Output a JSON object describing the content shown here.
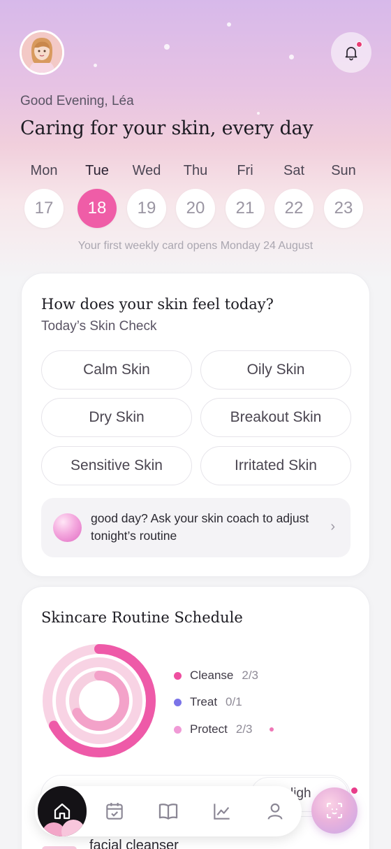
{
  "header": {
    "greeting": "Good Evening, Léa",
    "headline": "Caring for your skin, every day",
    "notification_dot_color": "#e83c74"
  },
  "week": {
    "days": [
      {
        "name": "Mon",
        "date": "17",
        "selected": false
      },
      {
        "name": "Tue",
        "date": "18",
        "selected": true
      },
      {
        "name": "Wed",
        "date": "19",
        "selected": false
      },
      {
        "name": "Thu",
        "date": "20",
        "selected": false
      },
      {
        "name": "Fri",
        "date": "21",
        "selected": false
      },
      {
        "name": "Sat",
        "date": "22",
        "selected": false
      },
      {
        "name": "Sun",
        "date": "23",
        "selected": false
      }
    ],
    "note": "Your first weekly card opens Monday 24 August",
    "accent": "#ef5da7"
  },
  "skin_check": {
    "title": "How does your skin feel today?",
    "subtitle": "Today’s Skin Check",
    "options": [
      "Calm Skin",
      "Oily Skin",
      "Dry Skin",
      "Breakout Skin",
      "Sensitive Skin",
      "Irritated Skin"
    ],
    "coach_prompt": "good day? Ask your skin coach to adjust tonight’s routine"
  },
  "routine": {
    "title": "Skincare Routine Schedule",
    "items": [
      {
        "label": "Cleanse",
        "count": "2/3",
        "color": "#ee4fa0"
      },
      {
        "label": "Treat",
        "count": "0/1",
        "color": "#7b74e8"
      },
      {
        "label": "Protect",
        "count": "2/3",
        "color": "#f09ad6"
      }
    ],
    "progress": {
      "cleanse": 0.67,
      "treat": 0.0,
      "protect": 0.67
    },
    "strip_partial_label": "ligh",
    "peek_text": "facial cleanser"
  },
  "nav": {
    "items": [
      "home-icon",
      "calendar-check-icon",
      "book-icon",
      "chart-icon",
      "profile-icon"
    ],
    "active": "home-icon",
    "scan_icon": "face-scan-icon"
  }
}
